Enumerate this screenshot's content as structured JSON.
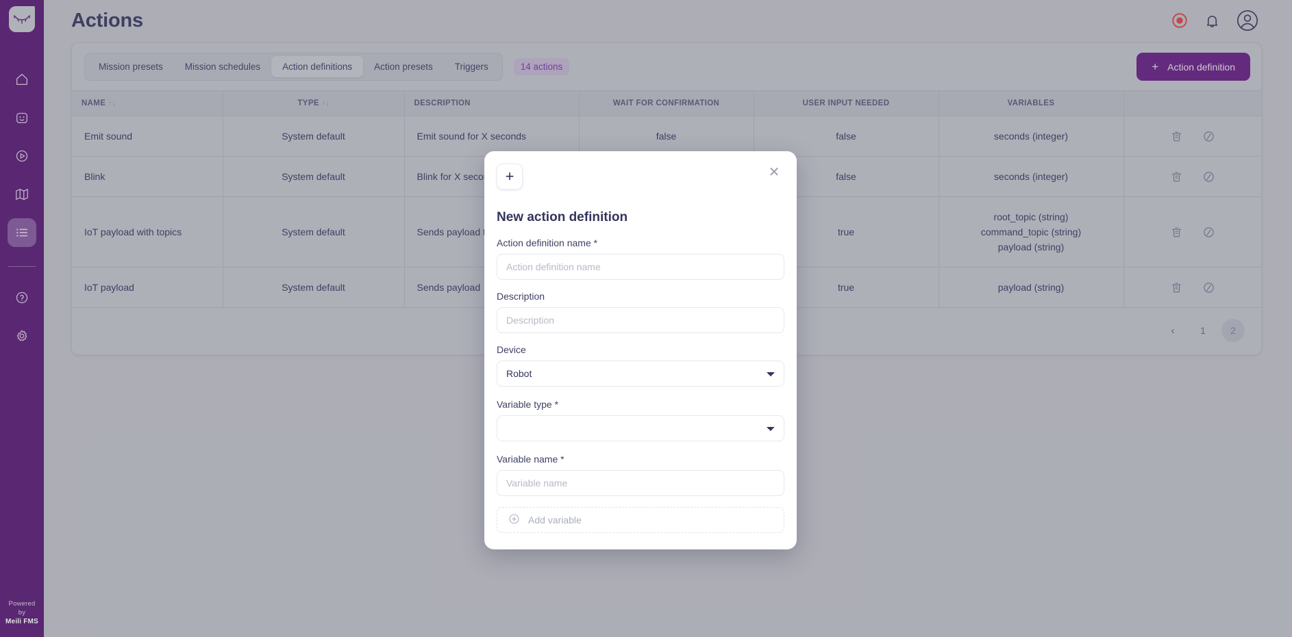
{
  "sidebar": {
    "logo_name": "meili-logo",
    "items": [
      {
        "name": "home",
        "label": "Home"
      },
      {
        "name": "robots",
        "label": "Robots"
      },
      {
        "name": "missions",
        "label": "Missions"
      },
      {
        "name": "maps",
        "label": "Maps"
      },
      {
        "name": "actions",
        "label": "Actions"
      }
    ],
    "bottom_items": [
      {
        "name": "help",
        "label": "Help"
      },
      {
        "name": "settings",
        "label": "Settings"
      }
    ],
    "powered_line1": "Powered",
    "powered_line2": "by",
    "powered_brand": "Meili FMS"
  },
  "header": {
    "title": "Actions",
    "record_icon": "record-icon",
    "bell_icon": "bell-icon",
    "avatar_icon": "user-avatar-icon"
  },
  "toolbar": {
    "tabs": [
      {
        "label": "Mission presets",
        "active": false
      },
      {
        "label": "Mission schedules",
        "active": false
      },
      {
        "label": "Action definitions",
        "active": true
      },
      {
        "label": "Action presets",
        "active": false
      },
      {
        "label": "Triggers",
        "active": false
      }
    ],
    "count_badge": "14 actions",
    "primary_button": "Action definition",
    "primary_button_icon": "plus-icon",
    "accent_color": "#6b2585",
    "badge_color": "#7b3fa8"
  },
  "table": {
    "columns": [
      {
        "label": "NAME",
        "sortable": true
      },
      {
        "label": "TYPE",
        "sortable": true
      },
      {
        "label": "DESCRIPTION",
        "sortable": false
      },
      {
        "label": "WAIT FOR CONFIRMATION",
        "sortable": false
      },
      {
        "label": "USER INPUT NEEDED",
        "sortable": false
      },
      {
        "label": "VARIABLES",
        "sortable": false
      },
      {
        "label": "",
        "sortable": false
      }
    ],
    "sort_glyph": "↑↓",
    "rows": [
      {
        "name": "Emit sound",
        "type": "System default",
        "description": "Emit sound for X seconds",
        "wait_for_confirmation": "false",
        "user_input_needed": "false",
        "variables": [
          "seconds (integer)"
        ]
      },
      {
        "name": "Blink",
        "type": "System default",
        "description": "Blink for X seconds",
        "wait_for_confirmation": "false",
        "user_input_needed": "false",
        "variables": [
          "seconds (integer)"
        ]
      },
      {
        "name": "IoT payload with topics",
        "type": "System default",
        "description": "Sends payload to specified topics",
        "wait_for_confirmation": "",
        "user_input_needed": "true",
        "variables": [
          "root_topic (string)",
          "command_topic (string)",
          "payload (string)"
        ]
      },
      {
        "name": "IoT payload",
        "type": "System default",
        "description": "Sends payload",
        "wait_for_confirmation": "",
        "user_input_needed": "true",
        "variables": [
          "payload (string)"
        ]
      }
    ],
    "row_action_icons": [
      "trash-icon",
      "edit-icon"
    ]
  },
  "pagination": {
    "prev": "‹",
    "pages": [
      "1",
      "2"
    ],
    "active_page": "2"
  },
  "modal": {
    "title": "New action definition",
    "plus_icon": "plus-icon",
    "close_icon": "close-icon",
    "fields": {
      "action_name_label": "Action definition name *",
      "action_name_placeholder": "Action definition name",
      "action_name_value": "",
      "description_label": "Description",
      "description_placeholder": "Description",
      "description_value": "",
      "device_label": "Device",
      "device_value": "Robot",
      "variable_type_label": "Variable type *",
      "variable_type_value": "",
      "variable_name_label": "Variable name *",
      "variable_name_placeholder": "Variable name",
      "variable_name_value": ""
    },
    "add_variable_label": "Add variable",
    "add_variable_icon": "plus-circle-icon"
  }
}
